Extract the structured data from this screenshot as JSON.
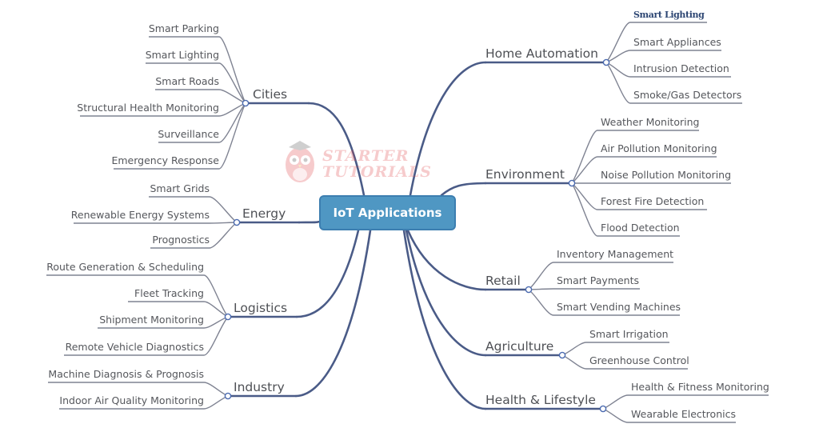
{
  "root": {
    "label": "IoT Applications"
  },
  "watermark": {
    "line1": "STARTER",
    "line2": "TUTORIALS"
  },
  "colors": {
    "root_fill": "#4f97c3",
    "branch_line": "#4a5b87",
    "leaf_line": "#7f8392",
    "junction": "#4a6ab0",
    "text": "#55575c"
  },
  "branches": [
    {
      "label": "Cities",
      "side": "left",
      "children": [
        "Smart Parking",
        "Smart Lighting",
        "Smart Roads",
        "Structural Health Monitoring",
        "Surveillance",
        "Emergency Response"
      ]
    },
    {
      "label": "Energy",
      "side": "left",
      "children": [
        "Smart Grids",
        "Renewable Energy Systems",
        "Prognostics"
      ]
    },
    {
      "label": "Logistics",
      "side": "left",
      "children": [
        "Route Generation & Scheduling",
        "Fleet Tracking",
        "Shipment Monitoring",
        "Remote Vehicle Diagnostics"
      ]
    },
    {
      "label": "Industry",
      "side": "left",
      "children": [
        "Machine Diagnosis & Prognosis",
        "Indoor Air Quality Monitoring"
      ]
    },
    {
      "label": "Home Automation",
      "side": "right",
      "children": [
        "Smart Lighting",
        "Smart Appliances",
        "Intrusion Detection",
        "Smoke/Gas Detectors"
      ]
    },
    {
      "label": "Environment",
      "side": "right",
      "children": [
        "Weather Monitoring",
        "Air Pollution Monitoring",
        "Noise Pollution Monitoring",
        "Forest Fire Detection",
        "Flood Detection"
      ]
    },
    {
      "label": "Retail",
      "side": "right",
      "children": [
        "Inventory Management",
        "Smart Payments",
        "Smart Vending Machines"
      ]
    },
    {
      "label": "Agriculture",
      "side": "right",
      "children": [
        "Smart Irrigation",
        "Greenhouse Control"
      ]
    },
    {
      "label": "Health & Lifestyle",
      "side": "right",
      "children": [
        "Health & Fitness Monitoring",
        "Wearable Electronics"
      ]
    }
  ]
}
